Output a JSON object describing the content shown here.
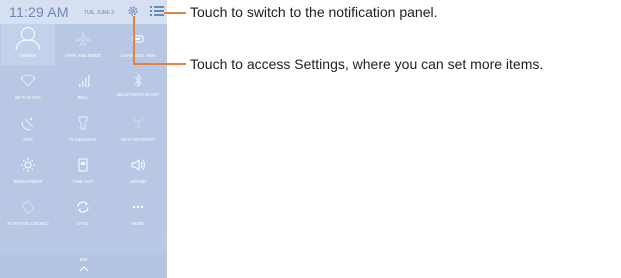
{
  "status_bar": {
    "time": "11:29 AM",
    "date": "TUE, JUNE 3"
  },
  "tiles": [
    {
      "label": "OWNER",
      "icon": "user-silhouette-icon"
    },
    {
      "label": "AIRPLANE MODE",
      "icon": "airplane-icon"
    },
    {
      "label": "CHARGING: 95%",
      "icon": "battery-icon"
    },
    {
      "label": "WI-FI IS OFF",
      "icon": "wifi-icon"
    },
    {
      "label": "BELL",
      "icon": "signal-bars-icon"
    },
    {
      "label": "BLUETOOTH IS OFF",
      "icon": "bluetooth-icon"
    },
    {
      "label": "GPS",
      "icon": "gps-icon"
    },
    {
      "label": "FLASHLIGHT",
      "icon": "flashlight-icon"
    },
    {
      "label": "WI-FI HOTSPOT",
      "icon": "hotspot-icon"
    },
    {
      "label": "BRIGHTNESS",
      "icon": "brightness-icon"
    },
    {
      "label": "TIME OUT",
      "icon": "timeout-icon"
    },
    {
      "label": "SOUND",
      "icon": "sound-icon"
    },
    {
      "label": "ROTATION LOCKED",
      "icon": "rotation-icon"
    },
    {
      "label": "SYNC",
      "icon": "sync-icon"
    },
    {
      "label": "MORE",
      "icon": "more-icon"
    }
  ],
  "bottom_label": "Bell",
  "callouts": {
    "notification": "Touch to switch to the notification panel.",
    "settings": "Touch to access Settings, where you can set more items."
  },
  "colors": {
    "panel": "#b9c9e5",
    "accent_text": "#6f86b8",
    "callout_line": "#e8823a"
  }
}
